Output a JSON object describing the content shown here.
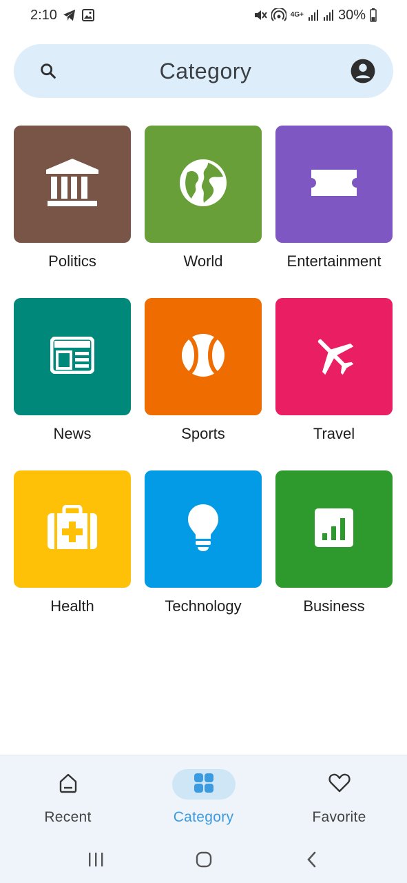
{
  "status_bar": {
    "time": "2:10",
    "network": "4G+",
    "battery": "30%"
  },
  "header": {
    "title": "Category",
    "search_icon": "search-icon",
    "account_icon": "account-circle-icon"
  },
  "categories": [
    {
      "label": "Politics",
      "icon": "bank-icon",
      "color": "#795548"
    },
    {
      "label": "World",
      "icon": "globe-icon",
      "color": "#689f38"
    },
    {
      "label": "Entertainment",
      "icon": "ticket-icon",
      "color": "#7e57c2"
    },
    {
      "label": "News",
      "icon": "newspaper-icon",
      "color": "#00897b"
    },
    {
      "label": "Sports",
      "icon": "baseball-icon",
      "color": "#ef6c00"
    },
    {
      "label": "Travel",
      "icon": "airplane-icon",
      "color": "#e91e63"
    },
    {
      "label": "Health",
      "icon": "medical-bag-icon",
      "color": "#ffc107"
    },
    {
      "label": "Technology",
      "icon": "lightbulb-icon",
      "color": "#039be5"
    },
    {
      "label": "Business",
      "icon": "bar-chart-icon",
      "color": "#2e9a2e"
    }
  ],
  "bottom_nav": {
    "items": [
      {
        "label": "Recent",
        "icon": "home-icon",
        "active": false
      },
      {
        "label": "Category",
        "icon": "grid-icon",
        "active": true
      },
      {
        "label": "Favorite",
        "icon": "heart-icon",
        "active": false
      }
    ],
    "active_color": "#3c9be0"
  },
  "system_nav": {
    "buttons": [
      "recents-icon",
      "home-circle-icon",
      "back-icon"
    ]
  }
}
